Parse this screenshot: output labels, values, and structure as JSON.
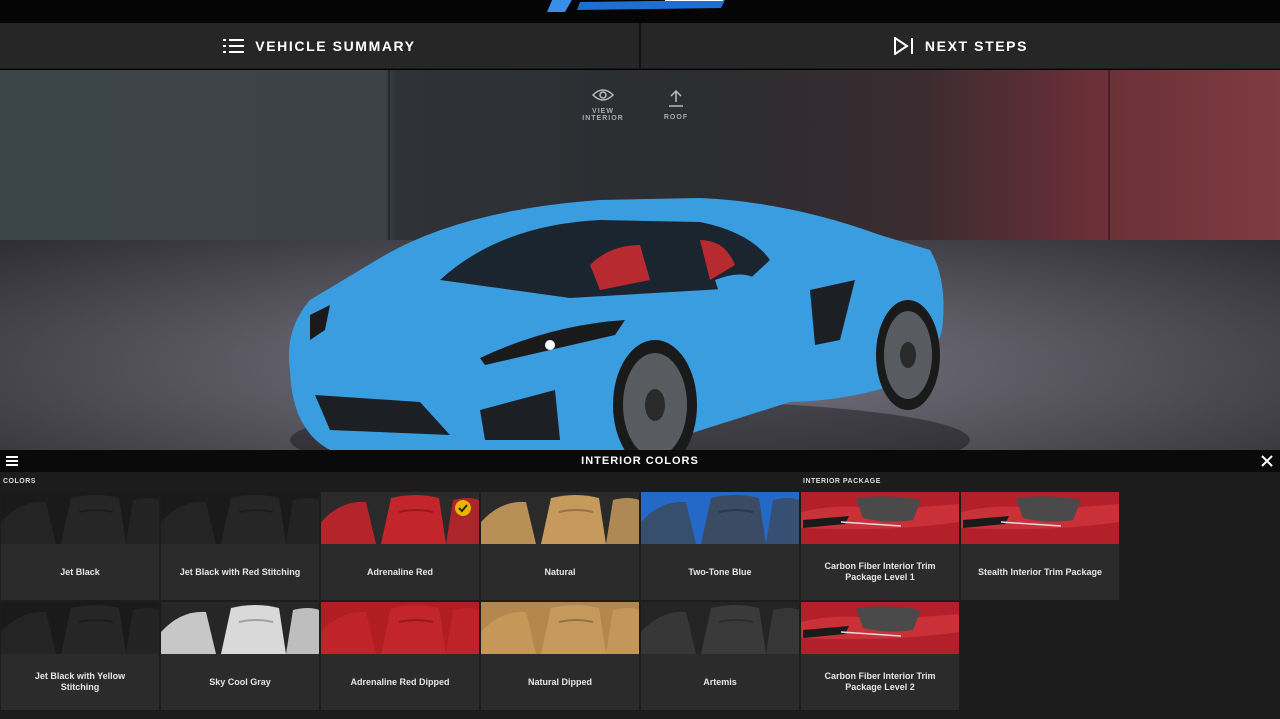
{
  "header": {
    "logo_text": "E-RAY",
    "nav": [
      {
        "label": "VEHICLE SUMMARY"
      },
      {
        "label": "NEXT STEPS"
      }
    ]
  },
  "stage": {
    "tools": [
      {
        "label": "VIEW INTERIOR",
        "icon": "eye-icon"
      },
      {
        "label": "ROOF",
        "icon": "roof-icon"
      }
    ],
    "car_color": "#3a9de0"
  },
  "panel": {
    "title": "INTERIOR COLORS",
    "colors_label": "COLORS",
    "package_label": "INTERIOR PACKAGE",
    "colors": [
      {
        "name": "Jet Black",
        "seat": "#262626",
        "accent": "#1a1a1a",
        "selected": false
      },
      {
        "name": "Jet Black with Red Stitching",
        "seat": "#262626",
        "accent": "#1a1a1a",
        "selected": false
      },
      {
        "name": "Adrenaline Red",
        "seat": "#c2252b",
        "accent": "#2a2a2a",
        "selected": true
      },
      {
        "name": "Natural",
        "seat": "#c69a5c",
        "accent": "#2a2a2a",
        "selected": false
      },
      {
        "name": "Two-Tone Blue",
        "seat": "#3b4b63",
        "accent": "#2469c8",
        "selected": false
      },
      {
        "name": "Jet Black with Yellow Stitching",
        "seat": "#262626",
        "accent": "#1a1a1a",
        "selected": false
      },
      {
        "name": "Sky Cool Gray",
        "seat": "#d9d9d9",
        "accent": "#262626",
        "selected": false
      },
      {
        "name": "Adrenaline Red Dipped",
        "seat": "#c2252b",
        "accent": "#b01e24",
        "selected": false
      },
      {
        "name": "Natural Dipped",
        "seat": "#c69a5c",
        "accent": "#b4884c",
        "selected": false
      },
      {
        "name": "Artemis",
        "seat": "#3a3a3a",
        "accent": "#242424",
        "selected": false
      }
    ],
    "packages": [
      {
        "name": "Carbon Fiber Interior Trim Package Level 1"
      },
      {
        "name": "Stealth Interior Trim Package"
      },
      {
        "name": "Carbon Fiber Interior Trim Package Level 2"
      }
    ]
  }
}
